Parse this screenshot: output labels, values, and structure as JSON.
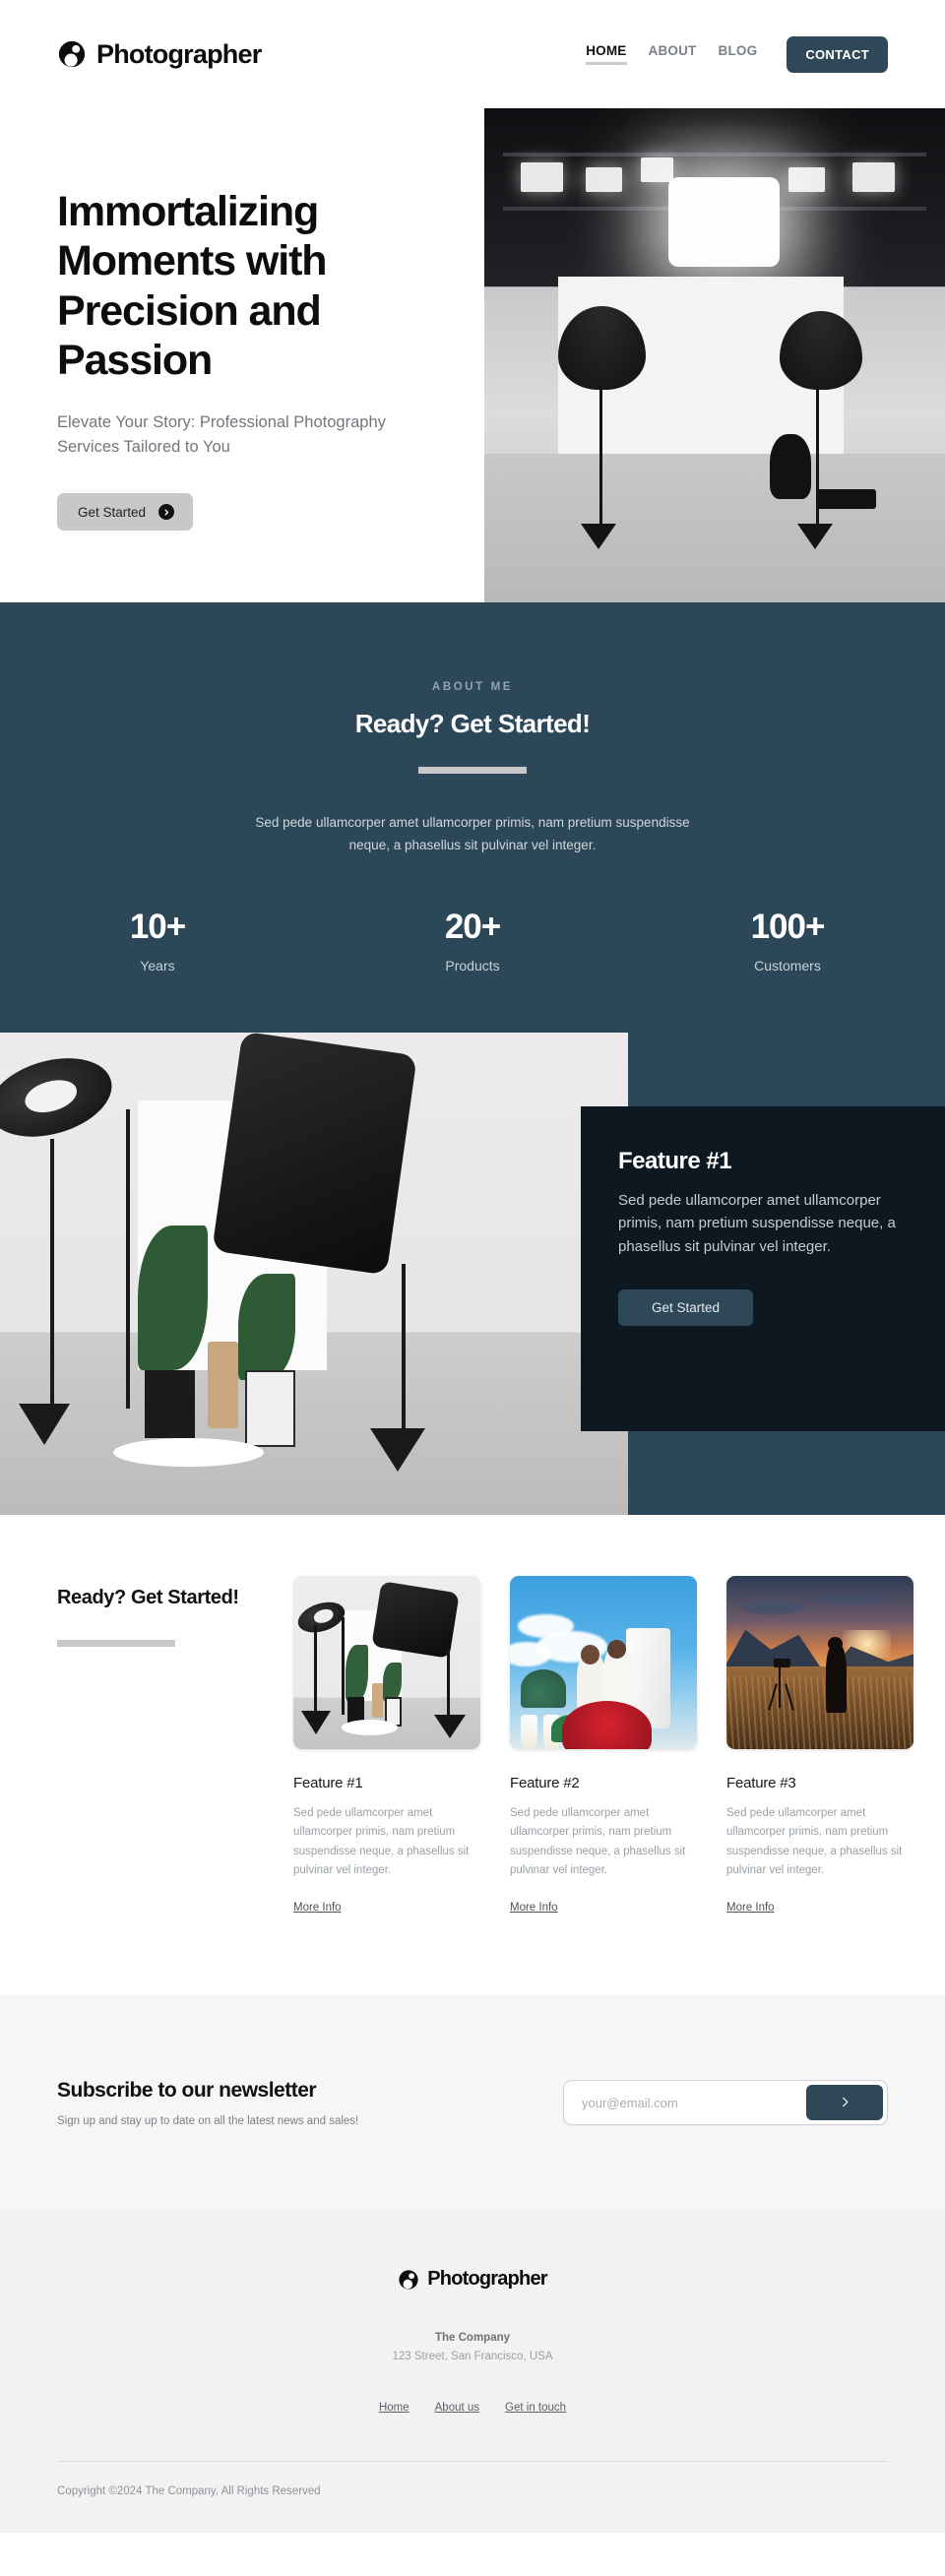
{
  "brand": {
    "name": "Photographer",
    "logo_icon": "camera-lens-icon"
  },
  "nav": {
    "links": [
      {
        "label": "HOME",
        "active": true
      },
      {
        "label": "ABOUT",
        "active": false
      },
      {
        "label": "BLOG",
        "active": false
      }
    ],
    "cta_label": "CONTACT"
  },
  "hero": {
    "title": "Immortalizing Moments with Precision and Passion",
    "subtitle": "Elevate Your Story: Professional Photography Services Tailored to You",
    "cta_label": "Get Started",
    "cta_icon": "arrow-right-circle-icon",
    "image_alt": "photography-studio-lighting-rig"
  },
  "about": {
    "eyebrow": "ABOUT ME",
    "title": "Ready? Get Started!",
    "body": "Sed pede ullamcorper amet ullamcorper primis, nam pretium suspendisse neque, a phasellus sit pulvinar vel integer.",
    "stats": [
      {
        "value": "10+",
        "label": "Years"
      },
      {
        "value": "20+",
        "label": "Products"
      },
      {
        "value": "100+",
        "label": "Customers"
      }
    ]
  },
  "split_feature": {
    "title": "Feature #1",
    "body": "Sed pede ullamcorper amet ullamcorper primis, nam pretium suspendisse neque, a phasellus sit pulvinar vel integer.",
    "cta_label": "Get Started",
    "image_alt": "studio-with-plants-and-softboxes"
  },
  "features": {
    "heading": "Ready? Get Started!",
    "cards": [
      {
        "title": "Feature #1",
        "body": "Sed pede ullamcorper amet ullamcorper primis, nam pretium suspendisse neque, a phasellus sit pulvinar vel integer.",
        "link_label": "More Info",
        "image_alt": "studio-lighting-with-plants"
      },
      {
        "title": "Feature #2",
        "body": "Sed pede ullamcorper amet ullamcorper primis, nam pretium suspendisse neque, a phasellus sit pulvinar vel integer.",
        "link_label": "More Info",
        "image_alt": "wedding-couple-with-roses"
      },
      {
        "title": "Feature #3",
        "body": "Sed pede ullamcorper amet ullamcorper primis, nam pretium suspendisse neque, a phasellus sit pulvinar vel integer.",
        "link_label": "More Info",
        "image_alt": "photographer-on-mountain-at-sunset"
      }
    ]
  },
  "newsletter": {
    "title": "Subscribe to our newsletter",
    "subtitle": "Sign up and stay up to date on all the latest news and sales!",
    "input_value": "",
    "input_placeholder": "your@email.com",
    "submit_icon": "chevron-right-icon"
  },
  "footer": {
    "brand_name": "Photographer",
    "company": "The Company",
    "address": "123 Street, San Francisco, USA",
    "links": [
      {
        "label": "Home"
      },
      {
        "label": "About us"
      },
      {
        "label": "Get in touch"
      }
    ],
    "copyright": "Copyright ©2024 The Company, All Rights Reserved"
  },
  "colors": {
    "accent_teal": "#2f4858",
    "section_teal": "#2c4757",
    "card_dark": "#0e1820",
    "muted_grey": "#c6c8ca",
    "newsletter_bg": "#f6f6f7",
    "footer_bg": "#f2f2f3"
  }
}
